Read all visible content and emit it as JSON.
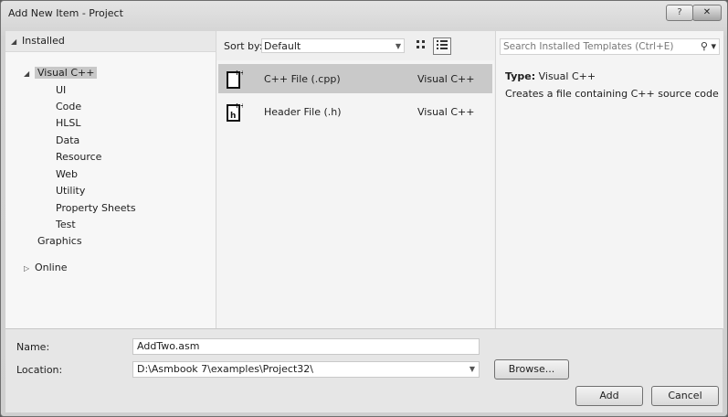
{
  "window": {
    "title": "Add New Item - Project",
    "help_glyph": "?",
    "close_glyph": "✕"
  },
  "tree": {
    "installed_label": "Installed",
    "root": "Visual C++",
    "children": [
      "UI",
      "Code",
      "HLSL",
      "Data",
      "Resource",
      "Web",
      "Utility",
      "Property Sheets",
      "Test"
    ],
    "graphics": "Graphics",
    "online": "Online"
  },
  "toolbar": {
    "sort_label": "Sort by:",
    "sort_value": "Default"
  },
  "templates": [
    {
      "name": "C++ File (.cpp)",
      "language": "Visual C++",
      "selected": true
    },
    {
      "name": "Header File (.h)",
      "language": "Visual C++",
      "selected": false
    }
  ],
  "details": {
    "search_placeholder": "Search Installed Templates (Ctrl+E)",
    "type_label": "Type:",
    "type_value": "Visual C++",
    "description": "Creates a file containing C++ source code"
  },
  "form": {
    "name_label": "Name:",
    "name_value": "AddTwo.asm",
    "location_label": "Location:",
    "location_value": "D:\\Asmbook 7\\examples\\Project32\\",
    "browse_label": "Browse...",
    "add_label": "Add",
    "cancel_label": "Cancel"
  }
}
